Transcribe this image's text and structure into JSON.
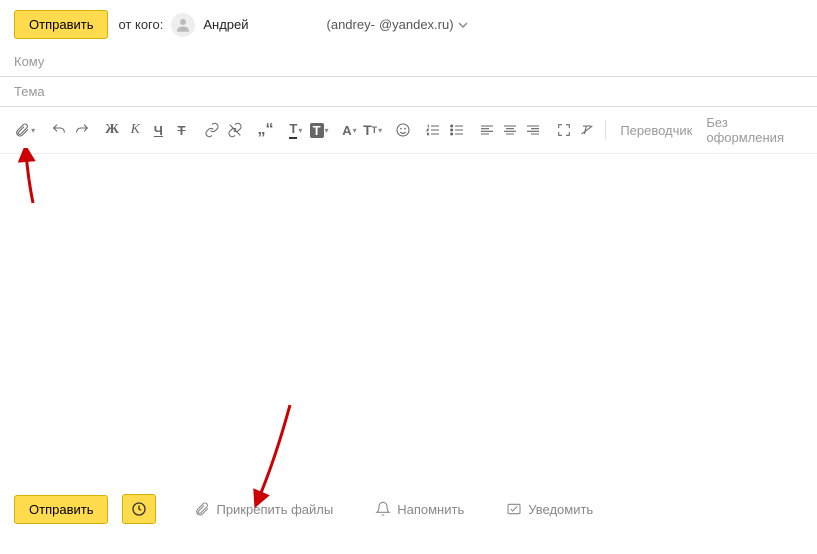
{
  "header": {
    "send_label": "Отправить",
    "from_label": "от кого:",
    "sender_name": "Андрей",
    "email_left": "(andrey-",
    "email_right": "@yandex.ru)"
  },
  "fields": {
    "to_placeholder": "Кому",
    "subject_placeholder": "Тема"
  },
  "toolbar": {
    "translator": "Переводчик",
    "plain": "Без оформления"
  },
  "bottom": {
    "send_label": "Отправить",
    "attach": "Прикрепить файлы",
    "remind": "Напомнить",
    "notify": "Уведомить"
  }
}
